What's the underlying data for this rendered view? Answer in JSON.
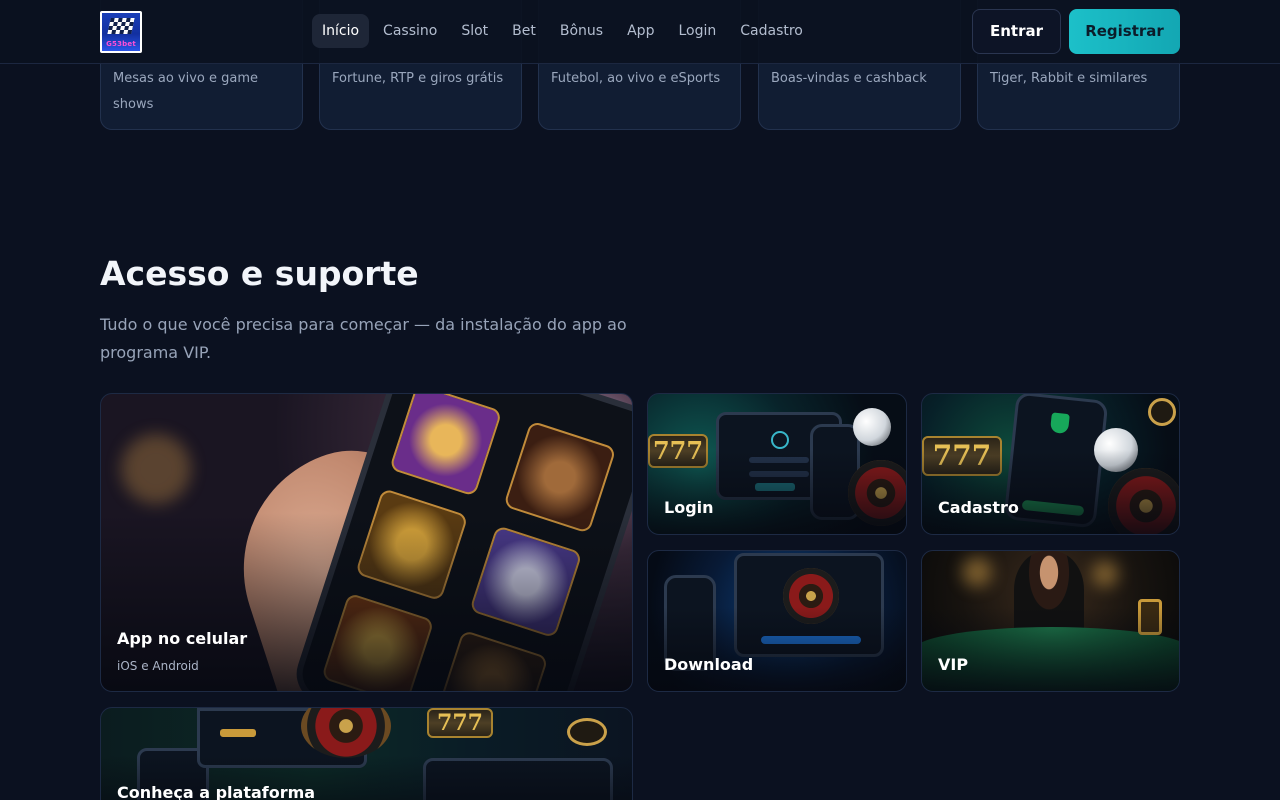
{
  "header": {
    "logo_text": "G53bet",
    "nav": [
      {
        "label": "Início",
        "active": true
      },
      {
        "label": "Cassino"
      },
      {
        "label": "Slot"
      },
      {
        "label": "Bet"
      },
      {
        "label": "Bônus"
      },
      {
        "label": "App"
      },
      {
        "label": "Login"
      },
      {
        "label": "Cadastro"
      }
    ],
    "enter_label": "Entrar",
    "register_label": "Registrar"
  },
  "categories": [
    {
      "desc": "Mesas ao vivo e game shows"
    },
    {
      "desc": "Fortune, RTP e giros grátis"
    },
    {
      "desc": "Futebol, ao vivo e eSports"
    },
    {
      "desc": "Boas-vindas e cashback"
    },
    {
      "desc": "Tiger, Rabbit e similares"
    }
  ],
  "section": {
    "title": "Acesso e suporte",
    "subtitle": "Tudo o que você precisa para começar — da instalação do app ao programa VIP."
  },
  "tiles": {
    "app": {
      "label": "App no celular",
      "sublabel": "iOS e Android"
    },
    "login": {
      "label": "Login"
    },
    "cadastro": {
      "label": "Cadastro"
    },
    "download": {
      "label": "Download"
    },
    "vip": {
      "label": "VIP"
    },
    "plataforma": {
      "label": "Conheça a plataforma"
    }
  },
  "colors": {
    "background": "#0b1120",
    "accent": "#1cc0c9",
    "card": "#111d33"
  }
}
